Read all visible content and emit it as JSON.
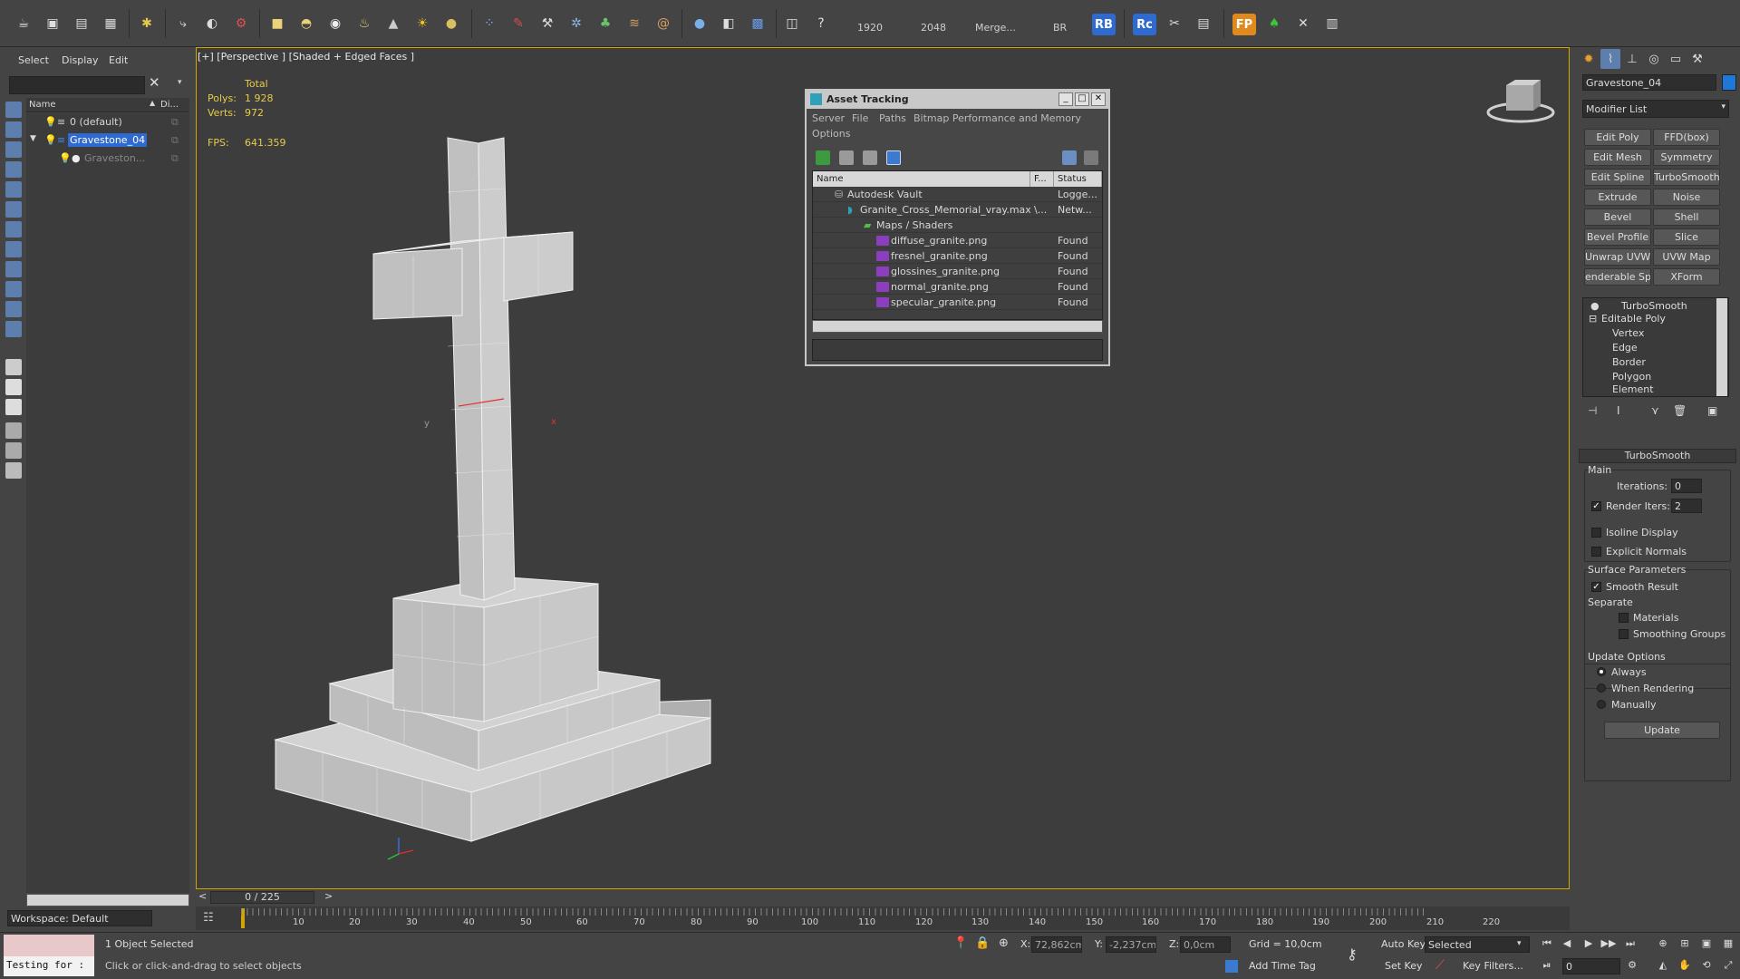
{
  "toolbar": {
    "render_width": "1920",
    "render_height": "2048",
    "merge_label": "Merge...",
    "br_label": "BR",
    "rb_badge": "RB",
    "rc_badge": "Rc",
    "fp_badge": "FP",
    "icons": [
      "teapot-icon",
      "render-frame-icon",
      "render-setup-icon",
      "scene-states-icon",
      "light-icon",
      "bend-icon",
      "sphere-icon",
      "box-icon",
      "dome-icon",
      "cylinder-icon",
      "teapot2-icon",
      "cone-icon",
      "sun-icon",
      "sphere-yellow-icon",
      "particles-icon",
      "paint-icon",
      "bone-icon",
      "gear-icon",
      "plant-icon",
      "hair-icon",
      "circle-icon",
      "material-icon",
      "grid-icon",
      "help-icon"
    ]
  },
  "scene_explorer": {
    "menu": [
      "Select",
      "Display",
      "Edit"
    ],
    "col_name": "Name",
    "col_display": "Di...",
    "rows": [
      {
        "label": "0 (default)",
        "selected": false
      },
      {
        "label": "Gravestone_04",
        "selected": true
      },
      {
        "label": "Graveston...",
        "selected": false
      }
    ],
    "workspace": "Workspace: Default"
  },
  "viewport": {
    "label": "[+] [Perspective ] [Shaded + Edged Faces ]",
    "stats_total": "Total",
    "polys_label": "Polys:",
    "polys_value": "1 928",
    "verts_label": "Verts:",
    "verts_value": "972",
    "fps_label": "FPS:",
    "fps_value": "641.359",
    "axis_y": "y",
    "axis_x": "x"
  },
  "asset_tracking": {
    "title": "Asset Tracking",
    "menu": [
      "Server",
      "File",
      "Paths",
      "Bitmap Performance and Memory",
      "Options"
    ],
    "col_name": "Name",
    "col_f": "F...",
    "col_status": "Status",
    "rows": [
      {
        "name": "Autodesk Vault",
        "f": "",
        "status": "Logge..."
      },
      {
        "name": "Granite_Cross_Memorial_vray.max",
        "f": "\\...",
        "status": "Netw..."
      },
      {
        "name": "Maps / Shaders",
        "f": "",
        "status": ""
      },
      {
        "name": "diffuse_granite.png",
        "f": "",
        "status": "Found"
      },
      {
        "name": "fresnel_granite.png",
        "f": "",
        "status": "Found"
      },
      {
        "name": "glossines_granite.png",
        "f": "",
        "status": "Found"
      },
      {
        "name": "normal_granite.png",
        "f": "",
        "status": "Found"
      },
      {
        "name": "specular_granite.png",
        "f": "",
        "status": "Found"
      }
    ]
  },
  "command_panel": {
    "object_name": "Gravestone_04",
    "object_color": "#1e78d8",
    "modifier_list": "Modifier List",
    "modifier_buttons": [
      "Edit Poly",
      "FFD(box)",
      "Edit Mesh",
      "Symmetry",
      "Edit Spline",
      "TurboSmooth",
      "Extrude",
      "Noise",
      "Bevel",
      "Shell",
      "Bevel Profile",
      "Slice",
      "Unwrap UVW",
      "UVW Map",
      "enderable Splir",
      "XForm"
    ],
    "stack": [
      "TurboSmooth",
      "Editable Poly",
      "Vertex",
      "Edge",
      "Border",
      "Polygon",
      "Element"
    ],
    "rollout_title": "TurboSmooth",
    "main_label": "Main",
    "iterations_label": "Iterations:",
    "iterations_value": "0",
    "render_iters_label": "Render Iters:",
    "render_iters_value": "2",
    "render_iters_checked": true,
    "isoline_label": "Isoline Display",
    "explicit_normals_label": "Explicit Normals",
    "surface_params_label": "Surface Parameters",
    "smooth_result_label": "Smooth Result",
    "separate_label": "Separate",
    "materials_label": "Materials",
    "smoothing_groups_label": "Smoothing Groups",
    "update_options_label": "Update Options",
    "always_label": "Always",
    "when_rendering_label": "When Rendering",
    "manually_label": "Manually",
    "update_button": "Update"
  },
  "time_slider": {
    "frame": "0 / 225",
    "ticks": [
      "10",
      "20",
      "30",
      "40",
      "50",
      "60",
      "70",
      "80",
      "90",
      "100",
      "110",
      "120",
      "130",
      "140",
      "150",
      "160",
      "170",
      "180",
      "190",
      "200",
      "210",
      "220"
    ]
  },
  "status_bar": {
    "maxscript": "Testing for :",
    "selection": "1 Object Selected",
    "prompt": "Click or click-and-drag to select objects",
    "x_label": "X:",
    "x_value": "72,862cm",
    "y_label": "Y:",
    "y_value": "-2,237cm",
    "z_label": "Z:",
    "z_value": "0,0cm",
    "grid": "Grid = 10,0cm",
    "add_time_tag": "Add Time Tag",
    "auto_key": "Auto Key",
    "set_key": "Set Key",
    "selected_option": "Selected",
    "key_filters": "Key Filters...",
    "frame_value": "0"
  }
}
